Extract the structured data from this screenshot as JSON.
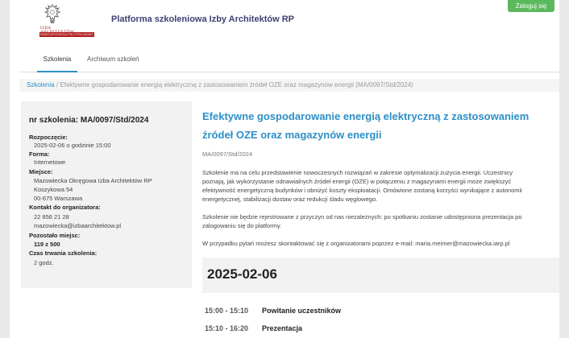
{
  "header": {
    "logo_text_top": "IZBA ARCHITEKTÓW",
    "logo_text_bottom": "RZECZPOSPOLITEJ POLSKIEJ",
    "platform_title": "Platforma szkoleniowa Izby Architektów RP",
    "login_label": "Zaloguj się"
  },
  "nav": {
    "tabs": [
      {
        "label": "Szkolenia",
        "active": true
      },
      {
        "label": "Archiwum szkoleń",
        "active": false
      }
    ]
  },
  "breadcrumb": {
    "root": "Szkolenia",
    "separator": "/",
    "current": "Efektywne gospodarowanie energią elektryczną z zastosowaniem źródeł OZE oraz magazynów energii (MA/0097/Std/2024)"
  },
  "sidebar": {
    "title": "nr szkolenia: MA/0097/Std/2024",
    "start_label": "Rozpoczęcie:",
    "start_value": "2025-02-06 o godzinie 15:00",
    "form_label": "Forma:",
    "form_value": "Internetowe",
    "place_label": "Miejsce:",
    "place_lines": [
      "Mazowiecka Okręgowa Izba Architektów RP",
      "Koszykowa 54",
      "00-675 Warszawa"
    ],
    "contact_label": "Kontakt do organizatora:",
    "contact_lines": [
      "22 856 21 28",
      "mazowiecka@izbaarchitektow.pl"
    ],
    "seats_label": "Pozostało miejsc:",
    "seats_value": "119 z 500",
    "duration_label": "Czas trwania szkolenia:",
    "duration_value": "2 godz."
  },
  "main": {
    "title": "Efektywne gospodarowanie energią elektryczną z zastosowaniem źródeł OZE oraz magazynów energii",
    "code": "MA/0097/Std/2024",
    "paragraph1": [
      "Szkolenie ma na celu przedstawienie nowoczesnych rozwiązań w zakresie optymalizacji zużycia energii. Uczestnicy",
      "poznają, jak wykorzystanie odnawialnych źródeł energii (OZE) w połączeniu z magazynami energii może zwiększyć",
      "efektywność energetyczną budynków i obniżyć koszty eksploatacji. Omówione zostaną korzyści wynikające z autonomii",
      "energetycznej, stabilizacji dostaw oraz redukcji śladu węglowego."
    ],
    "paragraph2": [
      "Szkolenie nie będzie rejestrowane z przyczyn od nas niezależnych: po spotkaniu zostanie udostępniona prezentacja po",
      "zalogowaniu się do platformy."
    ],
    "paragraph3": "W przypadku pytań możesz skontaktować się z organizatorami poprzez e-mail: maria.meimer@mazowiecka.iarp.pl",
    "date": "2025-02-06",
    "agenda": [
      {
        "time": "15:00 - 15:10",
        "title": "Powitanie uczestników"
      },
      {
        "time": "15:10 - 16:20",
        "title": "Prezentacja"
      }
    ]
  }
}
